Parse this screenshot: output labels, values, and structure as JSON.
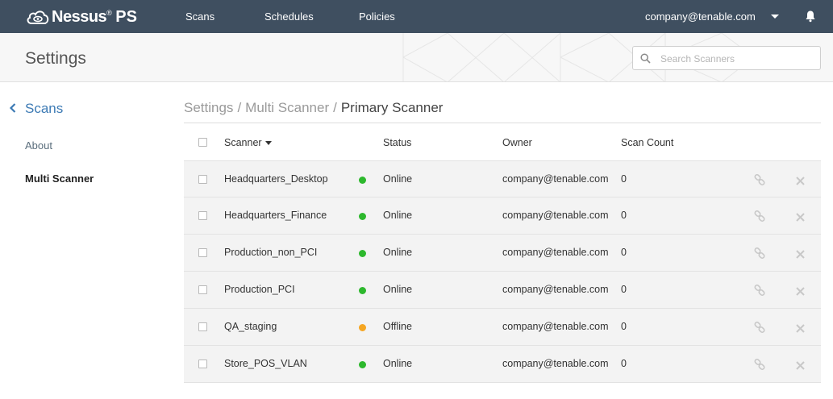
{
  "brand": {
    "name": "Nessus",
    "trademark": "®",
    "edition": "PS",
    "logo_icon": "cloud-eye-logo"
  },
  "topnav": {
    "items": [
      "Scans",
      "Schedules",
      "Policies"
    ],
    "user_email": "company@tenable.com",
    "caret_icon": "caret-down-icon",
    "bell_icon": "bell-icon"
  },
  "header": {
    "title": "Settings",
    "search_placeholder": "Search Scanners"
  },
  "sidebar": {
    "back_label": "Scans",
    "items": [
      {
        "label": "About",
        "active": false
      },
      {
        "label": "Multi Scanner",
        "active": true
      }
    ]
  },
  "breadcrumb": {
    "root": "Settings",
    "parent": "Multi Scanner",
    "current": "Primary Scanner",
    "separator": "/"
  },
  "table": {
    "columns": {
      "scanner": "Scanner",
      "status": "Status",
      "owner": "Owner",
      "scan_count": "Scan Count"
    },
    "rows": [
      {
        "scanner": "Headquarters_Desktop",
        "status": "Online",
        "owner": "company@tenable.com",
        "scan_count": "0"
      },
      {
        "scanner": "Headquarters_Finance",
        "status": "Online",
        "owner": "company@tenable.com",
        "scan_count": "0"
      },
      {
        "scanner": "Production_non_PCI",
        "status": "Online",
        "owner": "company@tenable.com",
        "scan_count": "0"
      },
      {
        "scanner": "Production_PCI",
        "status": "Online",
        "owner": "company@tenable.com",
        "scan_count": "0"
      },
      {
        "scanner": "QA_staging",
        "status": "Offline",
        "owner": "company@tenable.com",
        "scan_count": "0"
      },
      {
        "scanner": "Store_POS_VLAN",
        "status": "Online",
        "owner": "company@tenable.com",
        "scan_count": "0"
      }
    ]
  },
  "colors": {
    "topbar": "#3f4f60",
    "link_blue": "#3c7ab4",
    "status_online": "#2db82d",
    "status_offline": "#f5a623"
  }
}
